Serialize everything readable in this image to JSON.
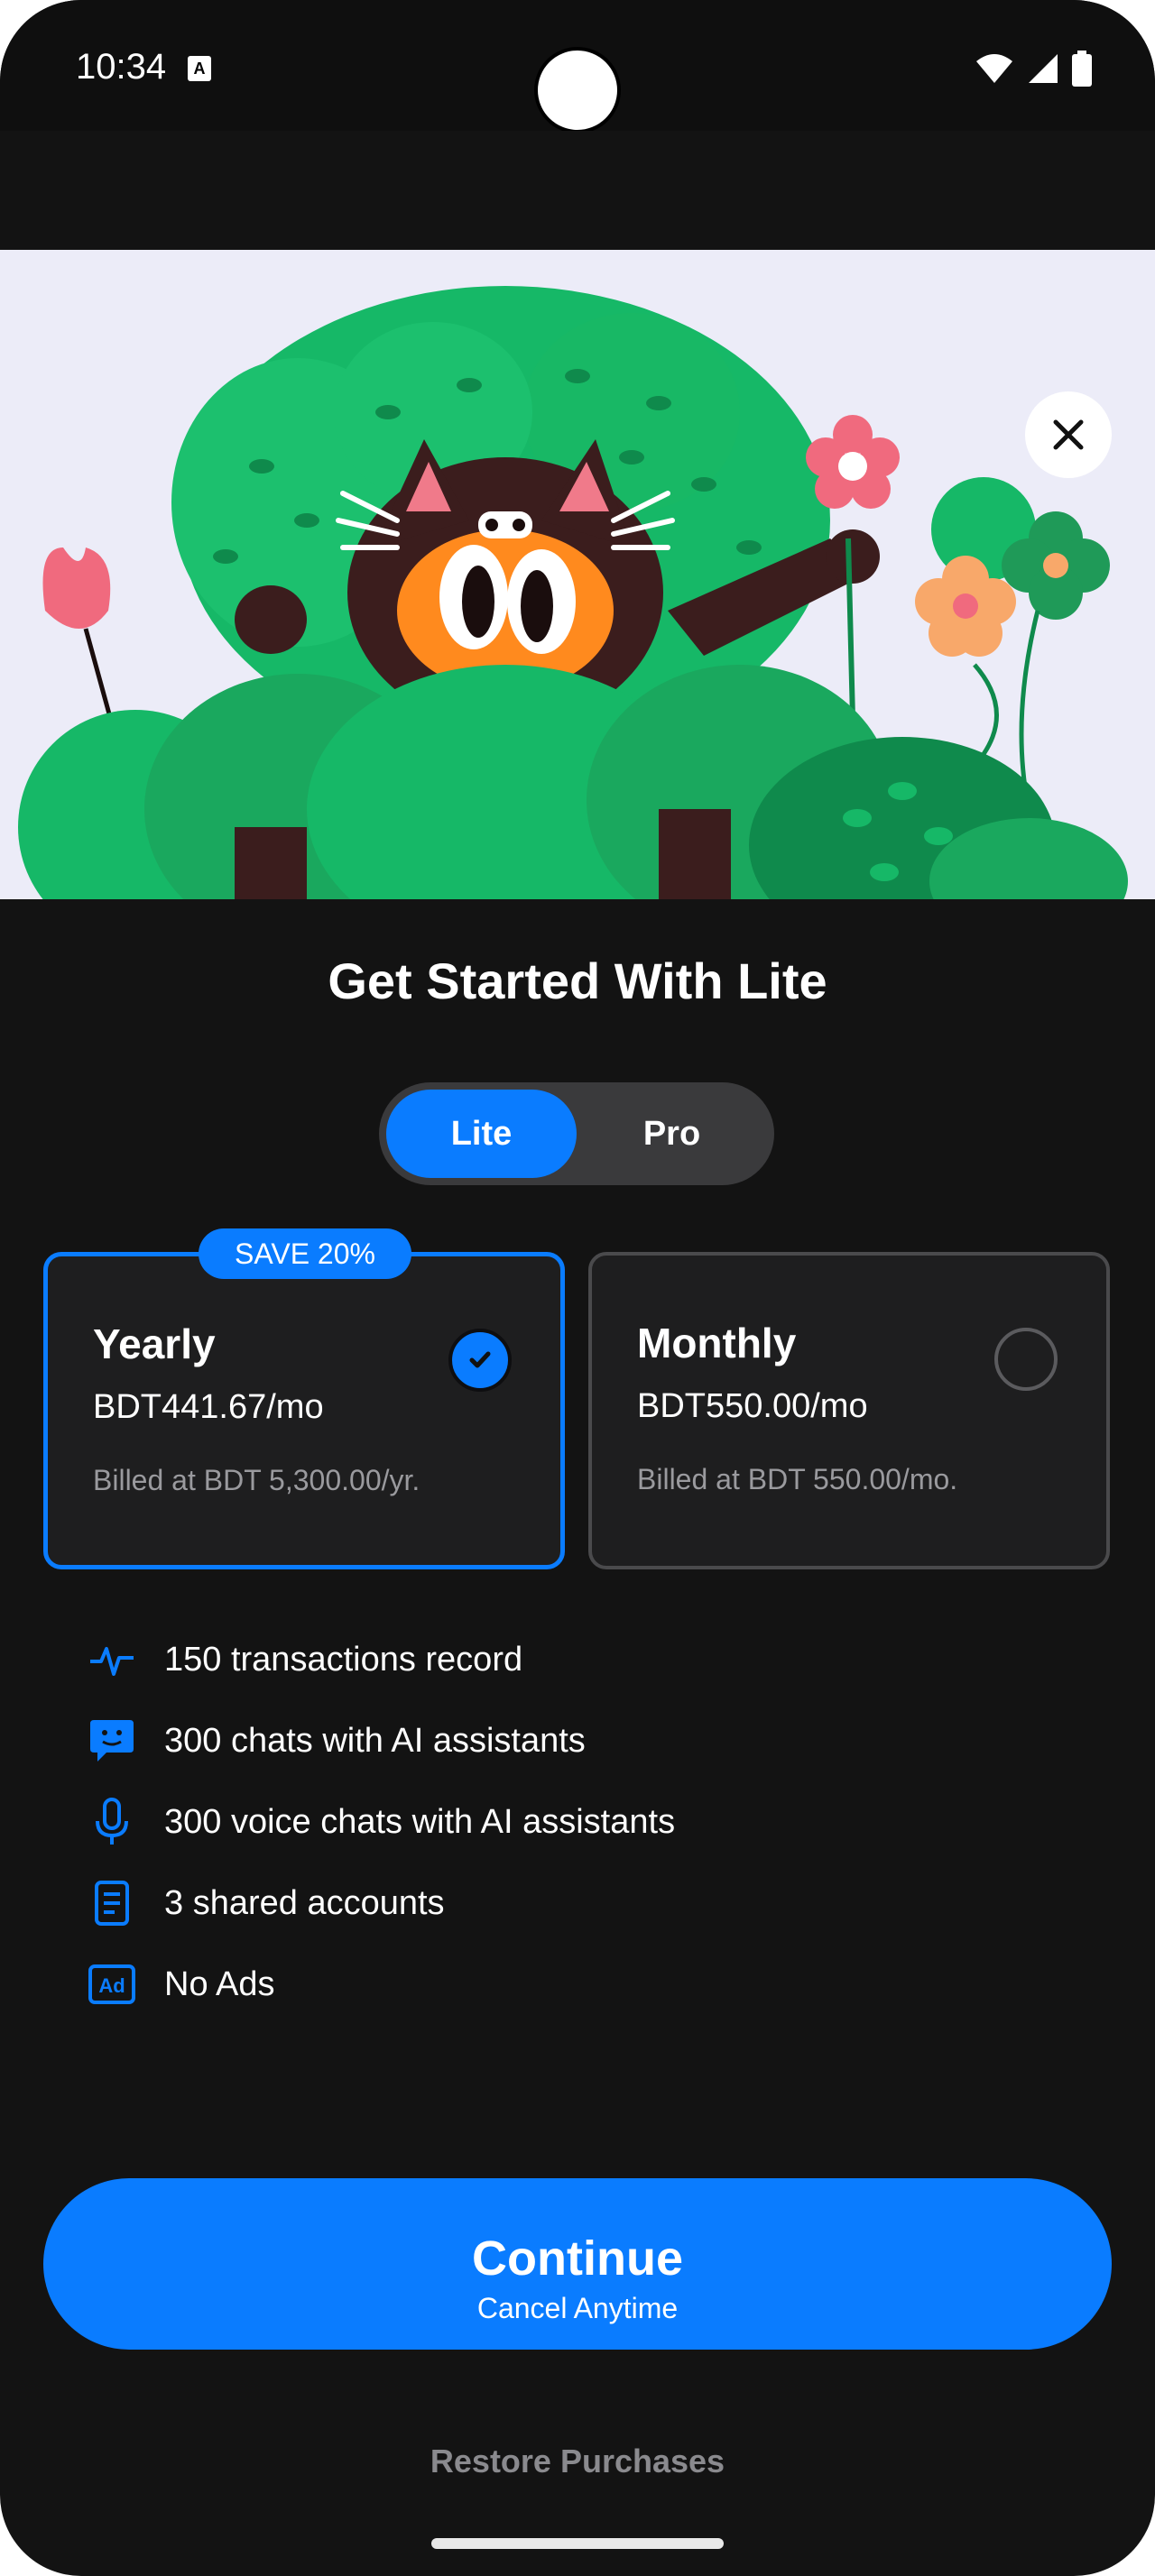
{
  "status_bar": {
    "time": "10:34",
    "badge": "A"
  },
  "hero": {
    "illustration": "cat peeking out of green bushes holding a pink flower"
  },
  "title": "Get Started With Lite",
  "plan_toggle": {
    "options": [
      "Lite",
      "Pro"
    ],
    "selected": "Lite"
  },
  "plans": {
    "yearly": {
      "badge": "SAVE 20%",
      "name": "Yearly",
      "price": "BDT441.67/mo",
      "billed": "Billed at BDT 5,300.00/yr.",
      "selected": true
    },
    "monthly": {
      "name": "Monthly",
      "price": "BDT550.00/mo",
      "billed": "Billed at BDT 550.00/mo.",
      "selected": false
    }
  },
  "features": [
    {
      "icon": "activity-icon",
      "text": "150 transactions record"
    },
    {
      "icon": "chat-bot-icon",
      "text": "300 chats with AI assistants"
    },
    {
      "icon": "microphone-icon",
      "text": "300 voice chats with AI assistants"
    },
    {
      "icon": "document-icon",
      "text": "3 shared accounts"
    },
    {
      "icon": "ad-icon",
      "text": "No Ads"
    }
  ],
  "continue_button": {
    "label": "Continue",
    "sublabel": "Cancel Anytime"
  },
  "restore_label": "Restore Purchases",
  "colors": {
    "accent": "#0a7cff",
    "background": "#131313",
    "card": "#1e1e1f"
  }
}
